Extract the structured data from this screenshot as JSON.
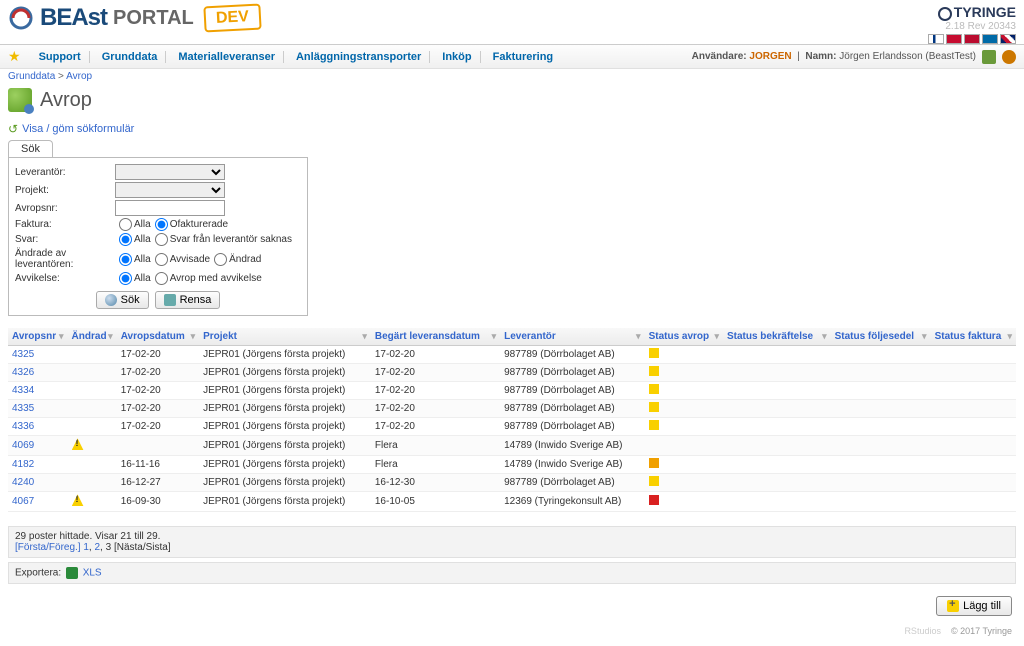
{
  "brand": {
    "beast": "BEAst",
    "portal": "PORTAL",
    "dev": "DEV",
    "tyringe": "TYRINGE",
    "version": "2.18 Rev 20343"
  },
  "nav": {
    "items": [
      "Support",
      "Grunddata",
      "Materialleveranser",
      "Anläggningstransporter",
      "Inköp",
      "Fakturering"
    ]
  },
  "user": {
    "label_user": "Användare:",
    "user": "JORGEN",
    "label_name": "Namn:",
    "name": "Jörgen Erlandsson (BeastTest)"
  },
  "breadcrumb": {
    "a": "Grunddata",
    "sep": ">",
    "b": "Avrop"
  },
  "title": "Avrop",
  "toggle": "Visa / göm sökformulär",
  "search": {
    "tab": "Sök",
    "labels": {
      "lev": "Leverantör:",
      "proj": "Projekt:",
      "avnr": "Avropsnr:",
      "fak": "Faktura:",
      "svar": "Svar:",
      "andr": "Ändrade av leverantören:",
      "avv": "Avvikelse:"
    },
    "radios": {
      "fak": [
        "Alla",
        "Ofakturerade"
      ],
      "svar": [
        "Alla",
        "Svar från leverantör saknas"
      ],
      "andr": [
        "Alla",
        "Avvisade",
        "Ändrad"
      ],
      "avv": [
        "Alla",
        "Avrop med avvikelse"
      ]
    },
    "btn_search": "Sök",
    "btn_clear": "Rensa"
  },
  "columns": [
    "Avropsnr",
    "Ändrad",
    "Avropsdatum",
    "Projekt",
    "Begärt leveransdatum",
    "Leverantör",
    "Status avrop",
    "Status bekräftelse",
    "Status följesedel",
    "Status faktura"
  ],
  "rows": [
    {
      "nr": "4325",
      "andr": "",
      "datum": "17-02-20",
      "proj": "JEPR01 (Jörgens första projekt)",
      "lev": "17-02-20",
      "levr": "987789 (Dörrbolaget AB)",
      "s1": "yellow"
    },
    {
      "nr": "4326",
      "andr": "",
      "datum": "17-02-20",
      "proj": "JEPR01 (Jörgens första projekt)",
      "lev": "17-02-20",
      "levr": "987789 (Dörrbolaget AB)",
      "s1": "yellow"
    },
    {
      "nr": "4334",
      "andr": "",
      "datum": "17-02-20",
      "proj": "JEPR01 (Jörgens första projekt)",
      "lev": "17-02-20",
      "levr": "987789 (Dörrbolaget AB)",
      "s1": "yellow"
    },
    {
      "nr": "4335",
      "andr": "",
      "datum": "17-02-20",
      "proj": "JEPR01 (Jörgens första projekt)",
      "lev": "17-02-20",
      "levr": "987789 (Dörrbolaget AB)",
      "s1": "yellow"
    },
    {
      "nr": "4336",
      "andr": "",
      "datum": "17-02-20",
      "proj": "JEPR01 (Jörgens första projekt)",
      "lev": "17-02-20",
      "levr": "987789 (Dörrbolaget AB)",
      "s1": "yellow"
    },
    {
      "nr": "4069",
      "andr": "warn",
      "datum": "",
      "proj": "JEPR01 (Jörgens första projekt)",
      "lev": "Flera",
      "levr": "14789 (Inwido Sverige AB)",
      "s1": ""
    },
    {
      "nr": "4182",
      "andr": "",
      "datum": "16-11-16",
      "proj": "JEPR01 (Jörgens första projekt)",
      "lev": "Flera",
      "levr": "14789 (Inwido Sverige AB)",
      "s1": "orange"
    },
    {
      "nr": "4240",
      "andr": "",
      "datum": "16-12-27",
      "proj": "JEPR01 (Jörgens första projekt)",
      "lev": "16-12-30",
      "levr": "987789 (Dörrbolaget AB)",
      "s1": "yellow"
    },
    {
      "nr": "4067",
      "andr": "warn",
      "datum": "16-09-30",
      "proj": "JEPR01 (Jörgens första projekt)",
      "lev": "16-10-05",
      "levr": "12369 (Tyringekonsult AB)",
      "s1": "red"
    }
  ],
  "pagination": {
    "summary": "29 poster hittade. Visar 21 till 29.",
    "first": "[Första/Föreg.]",
    "pages": [
      "1",
      "2",
      "3"
    ],
    "last": "[Nästa/Sista]"
  },
  "export": {
    "label": "Exportera:",
    "xls": "XLS"
  },
  "add": "Lägg till",
  "footer": {
    "left": "RStudios",
    "right": "© 2017 Tyringe"
  }
}
